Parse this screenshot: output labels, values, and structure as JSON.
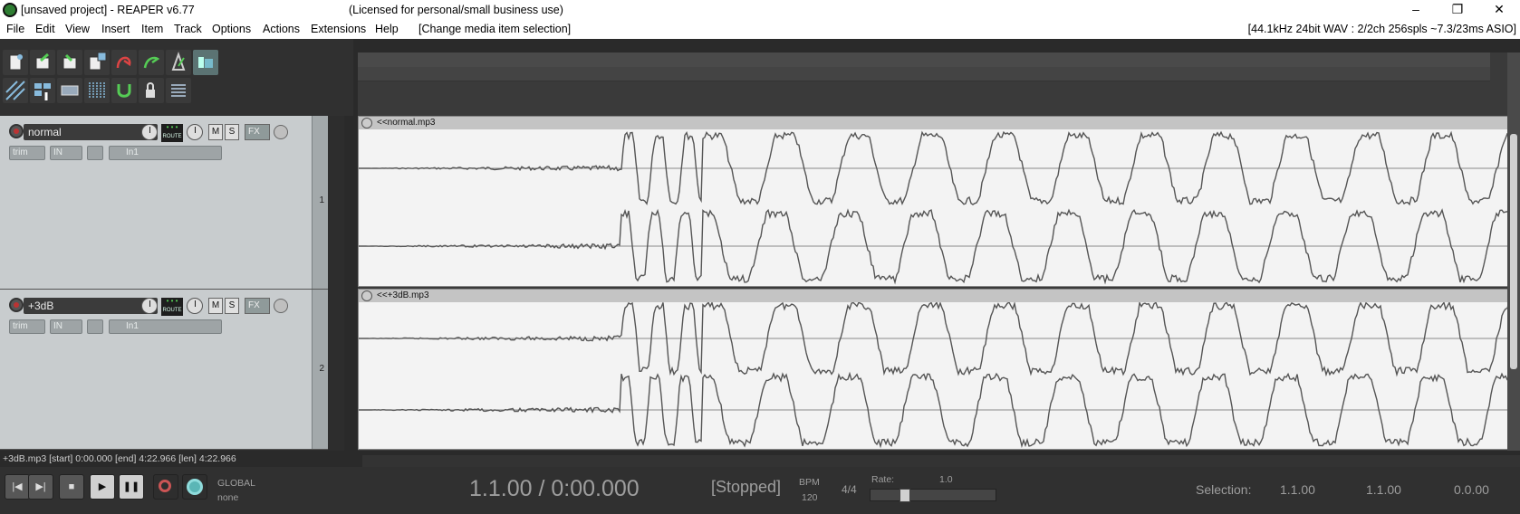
{
  "window": {
    "title": "[unsaved project] - REAPER v6.77",
    "license": "(Licensed for personal/small business use)",
    "minimize": "–",
    "maximize": "❐",
    "close": "✕"
  },
  "menu": {
    "items": [
      "File",
      "Edit",
      "View",
      "Insert",
      "Item",
      "Track",
      "Options",
      "Actions",
      "Extensions",
      "Help",
      "[Change media item selection]"
    ],
    "audio_status": "[44.1kHz 24bit WAV : 2/2ch 256spls ~7.3/23ms ASIO]"
  },
  "toolbar": {
    "icons": [
      "new-project-icon",
      "open-project-icon",
      "save-project-icon",
      "project-settings-icon",
      "undo-icon",
      "redo-icon",
      "metronome-icon",
      "ripple-edit-icon",
      "grid-icon",
      "item-grouping-icon",
      "snap-icon",
      "lock-icon",
      "envelope-icon",
      "marker-icon",
      "show-list-icon"
    ]
  },
  "tracks": [
    {
      "name": "normal",
      "number": "1",
      "trim": "trim",
      "input": "IN",
      "input_channel": "In1",
      "mute": "M",
      "solo": "S",
      "fx": "FX",
      "route": "ROUTE"
    },
    {
      "name": "+3dB",
      "number": "2",
      "trim": "trim",
      "input": "IN",
      "input_channel": "In1",
      "mute": "M",
      "solo": "S",
      "fx": "FX",
      "route": "ROUTE"
    }
  ],
  "items": [
    {
      "name": "<<normal.mp3"
    },
    {
      "name": "<<+3dB.mp3"
    }
  ],
  "status_line": "+3dB.mp3 [start] 0:00.000 [end] 4:22.966 [len] 4:22.966",
  "transport": {
    "position": "1.1.00 / 0:00.000",
    "state": "[Stopped]",
    "bpm_label": "BPM",
    "bpm": "120",
    "time_sig": "4/4",
    "rate_label": "Rate:",
    "rate": "1.0",
    "rate_fraction": 0.25,
    "global_label": "GLOBAL",
    "global_value": "none",
    "selection_label": "Selection:",
    "selection_start": "1.1.00",
    "selection_end": "1.1.00",
    "selection_length": "0.0.00"
  },
  "colors": {
    "background": "#2a2a2a",
    "track_panel": "#c8ccce",
    "item_bg": "#f3f3f3",
    "waveform": "#555555"
  }
}
